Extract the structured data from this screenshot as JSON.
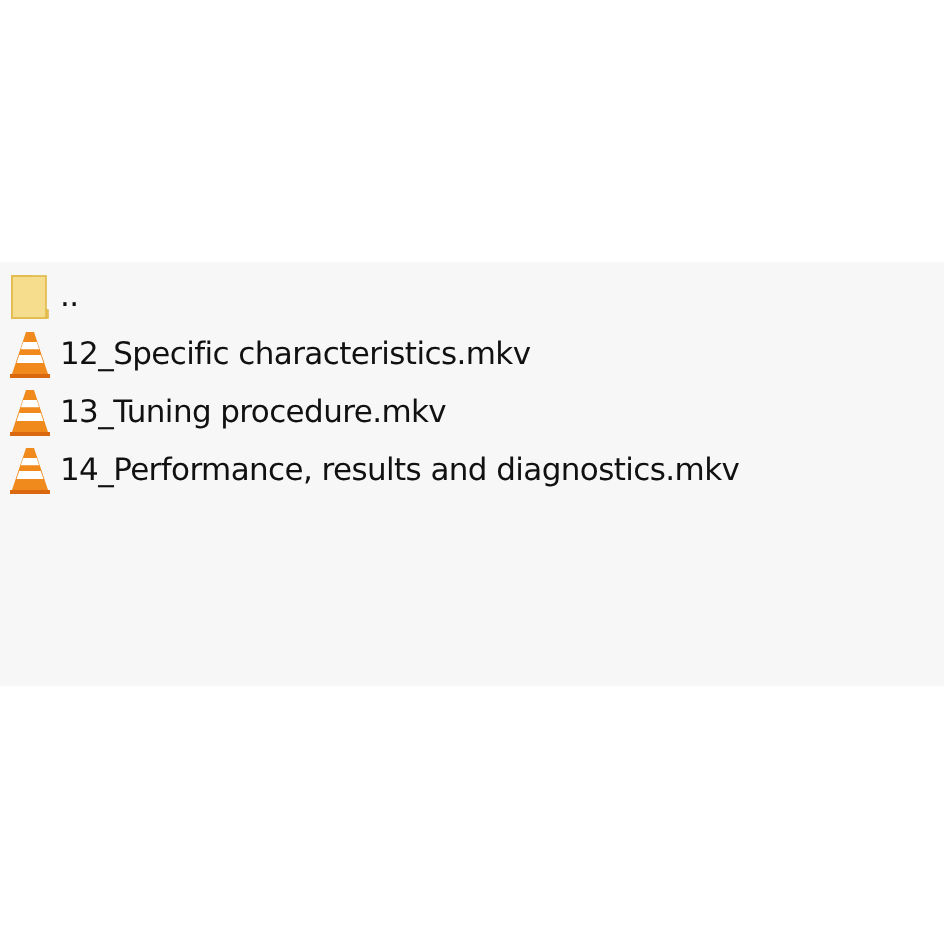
{
  "files": [
    {
      "kind": "folder",
      "name": ".."
    },
    {
      "kind": "video",
      "name": "12_Specific characteristics.mkv"
    },
    {
      "kind": "video",
      "name": "13_Tuning procedure.mkv"
    },
    {
      "kind": "video",
      "name": "14_Performance, results and diagnostics.mkv"
    }
  ]
}
